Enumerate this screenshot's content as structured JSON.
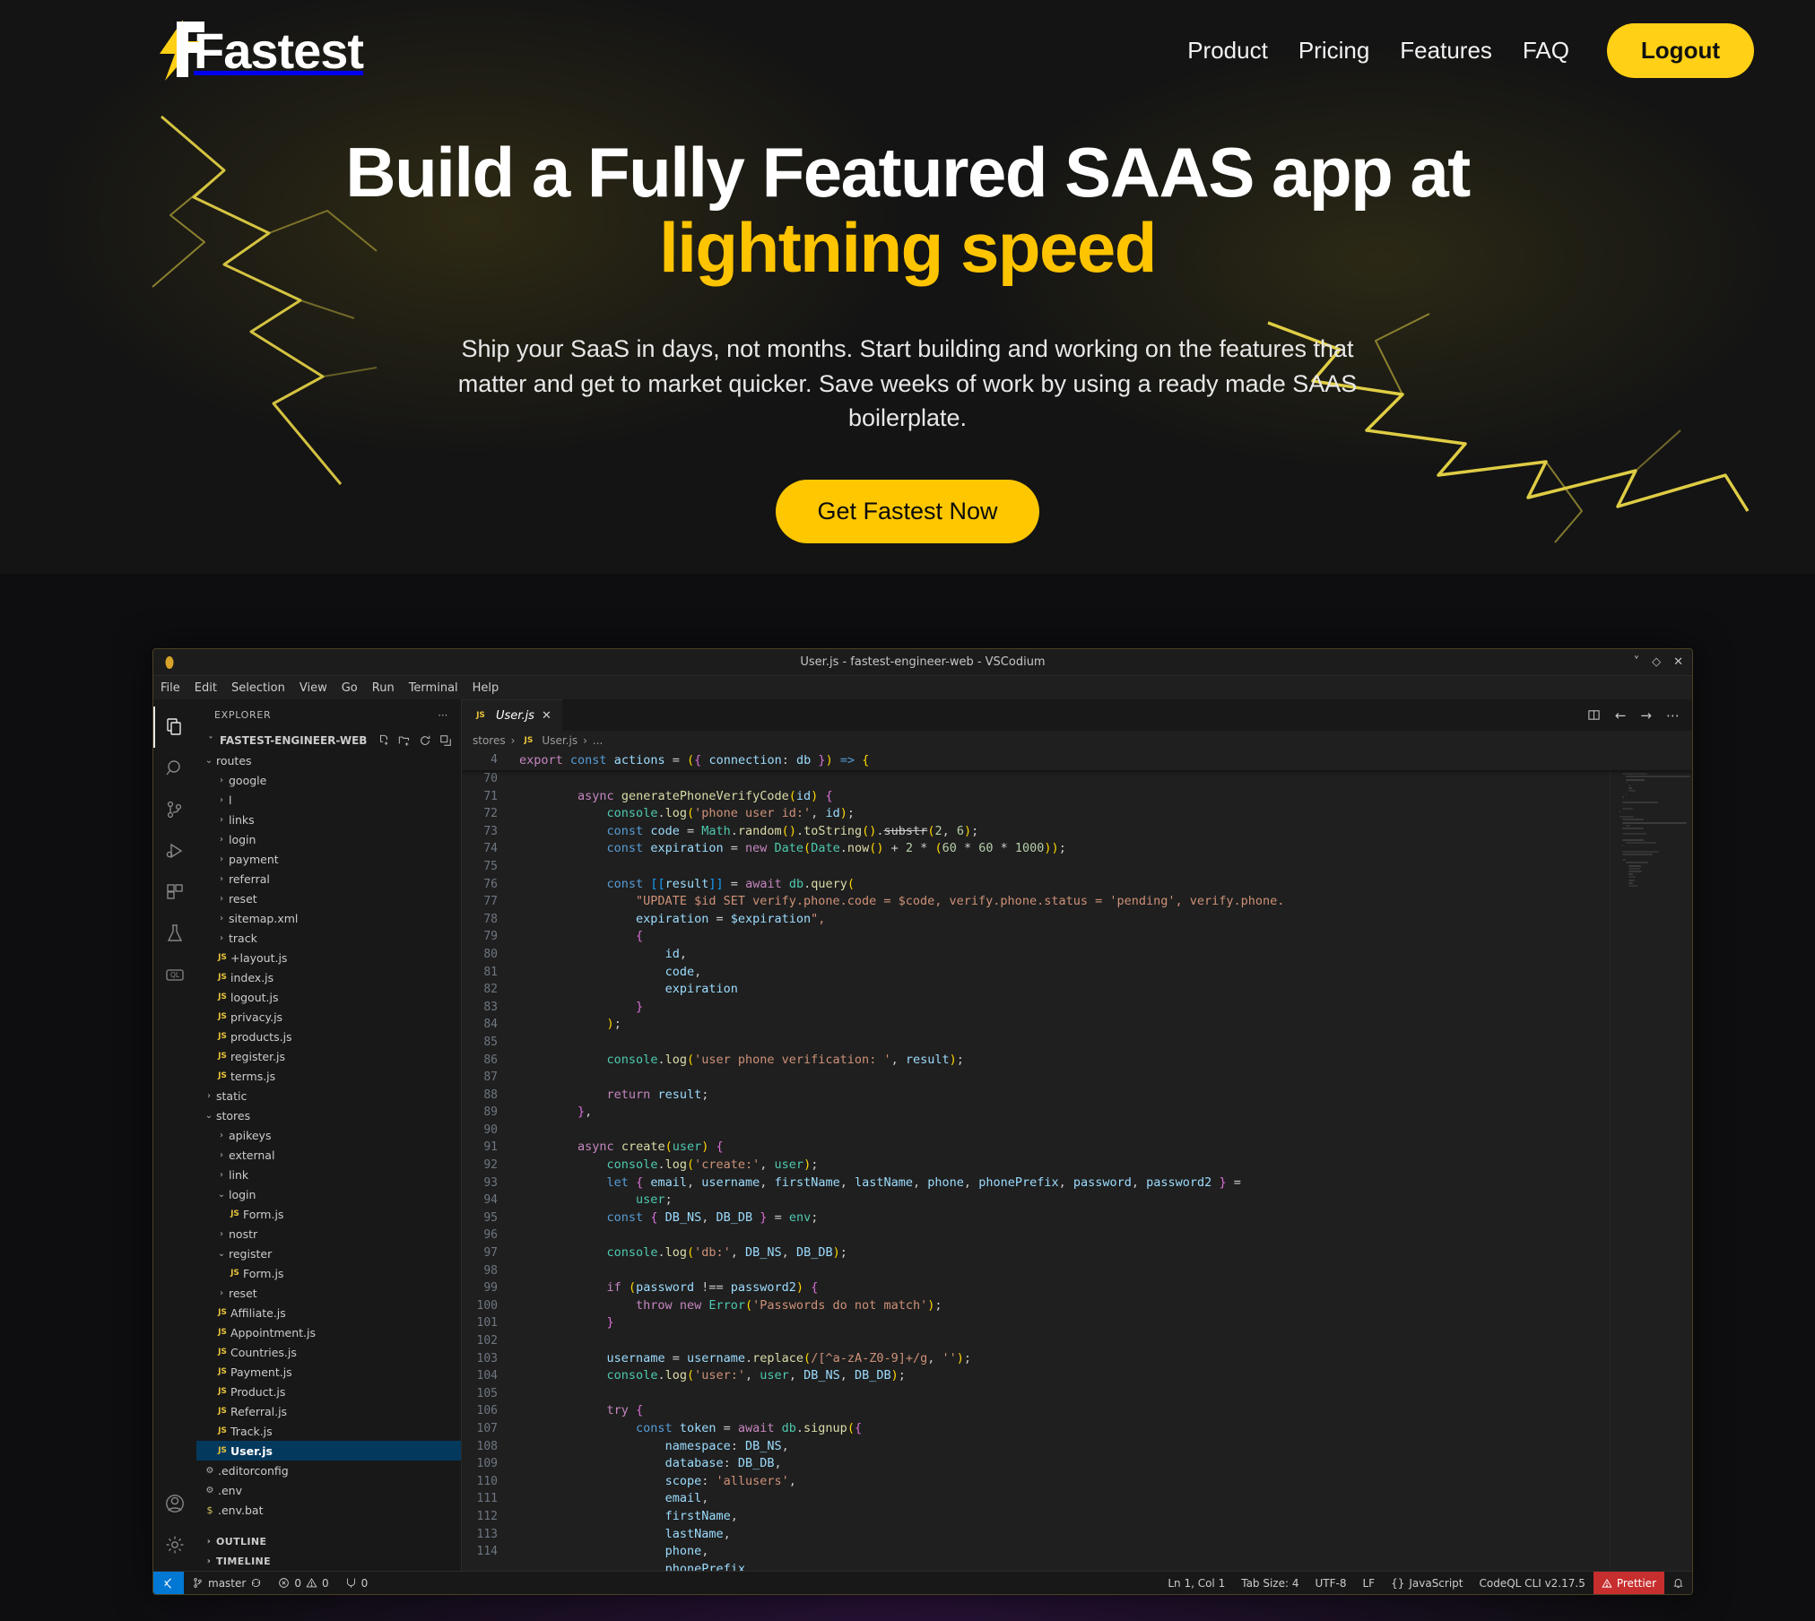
{
  "brand": {
    "name": "Fastest",
    "logo_icon": "lightning-bolt-icon"
  },
  "nav": {
    "links": [
      {
        "label": "Product"
      },
      {
        "label": "Pricing"
      },
      {
        "label": "Features"
      },
      {
        "label": "FAQ"
      }
    ],
    "logout_label": "Logout",
    "accent_color": "#FFD015"
  },
  "hero": {
    "headline_line1": "Build a Fully Featured SAAS app at",
    "headline_line2": "lightning speed",
    "subtitle": "Ship your SaaS in days, not months. Start building and working on the features that matter and get to market quicker. Save weeks of work by using a ready made SAAS boilerplate.",
    "cta_label": "Get Fastest Now",
    "accent_color": "#FFC400"
  },
  "editor": {
    "window_title": "User.js - fastest-engineer-web - VSCodium",
    "window_controls": {
      "minimize": "chevron-down-icon",
      "maximize": "diamond-icon",
      "close": "close-icon"
    },
    "menu": [
      "File",
      "Edit",
      "Selection",
      "View",
      "Go",
      "Run",
      "Terminal",
      "Help"
    ],
    "activity_bar": [
      {
        "name": "explorer-icon",
        "label": "Explorer",
        "active": true
      },
      {
        "name": "search-icon",
        "label": "Search",
        "active": false
      },
      {
        "name": "source-control-icon",
        "label": "Source Control",
        "active": false
      },
      {
        "name": "run-debug-icon",
        "label": "Run and Debug",
        "active": false
      },
      {
        "name": "extensions-icon",
        "label": "Extensions",
        "active": false
      },
      {
        "name": "testing-flask-icon",
        "label": "Testing",
        "active": false
      },
      {
        "name": "codeql-icon",
        "label": "CodeQL",
        "active": false
      }
    ],
    "activity_bar_bottom": [
      {
        "name": "account-icon",
        "label": "Accounts"
      },
      {
        "name": "gear-icon",
        "label": "Manage"
      }
    ],
    "explorer": {
      "title": "EXPLORER",
      "more_icon": "ellipsis-icon",
      "root": "FASTEST-ENGINEER-WEB",
      "root_actions": [
        "new-file-icon",
        "new-folder-icon",
        "refresh-icon",
        "collapse-all-icon"
      ],
      "tree": [
        {
          "label": "routes",
          "type": "folder",
          "state": "open",
          "depth": 1
        },
        {
          "label": "google",
          "type": "folder",
          "state": "closed",
          "depth": 2,
          "clipped": true
        },
        {
          "label": "l",
          "type": "folder",
          "state": "closed",
          "depth": 2
        },
        {
          "label": "links",
          "type": "folder",
          "state": "closed",
          "depth": 2
        },
        {
          "label": "login",
          "type": "folder",
          "state": "closed",
          "depth": 2
        },
        {
          "label": "payment",
          "type": "folder",
          "state": "closed",
          "depth": 2
        },
        {
          "label": "referral",
          "type": "folder",
          "state": "closed",
          "depth": 2
        },
        {
          "label": "reset",
          "type": "folder",
          "state": "closed",
          "depth": 2
        },
        {
          "label": "sitemap.xml",
          "type": "folder",
          "state": "closed",
          "depth": 2
        },
        {
          "label": "track",
          "type": "folder",
          "state": "closed",
          "depth": 2
        },
        {
          "label": "+layout.js",
          "type": "js",
          "depth": 2
        },
        {
          "label": "index.js",
          "type": "js",
          "depth": 2
        },
        {
          "label": "logout.js",
          "type": "js",
          "depth": 2
        },
        {
          "label": "privacy.js",
          "type": "js",
          "depth": 2
        },
        {
          "label": "products.js",
          "type": "js",
          "depth": 2
        },
        {
          "label": "register.js",
          "type": "js",
          "depth": 2
        },
        {
          "label": "terms.js",
          "type": "js",
          "depth": 2
        },
        {
          "label": "static",
          "type": "folder",
          "state": "closed",
          "depth": 1
        },
        {
          "label": "stores",
          "type": "folder",
          "state": "open",
          "depth": 1
        },
        {
          "label": "apikeys",
          "type": "folder",
          "state": "closed",
          "depth": 2
        },
        {
          "label": "external",
          "type": "folder",
          "state": "closed",
          "depth": 2
        },
        {
          "label": "link",
          "type": "folder",
          "state": "closed",
          "depth": 2
        },
        {
          "label": "login",
          "type": "folder",
          "state": "open",
          "depth": 2
        },
        {
          "label": "Form.js",
          "type": "js",
          "depth": 3
        },
        {
          "label": "nostr",
          "type": "folder",
          "state": "closed",
          "depth": 2
        },
        {
          "label": "register",
          "type": "folder",
          "state": "open",
          "depth": 2
        },
        {
          "label": "Form.js",
          "type": "js",
          "depth": 3
        },
        {
          "label": "reset",
          "type": "folder",
          "state": "closed",
          "depth": 2
        },
        {
          "label": "Affiliate.js",
          "type": "js",
          "depth": 2
        },
        {
          "label": "Appointment.js",
          "type": "js",
          "depth": 2
        },
        {
          "label": "Countries.js",
          "type": "js",
          "depth": 2
        },
        {
          "label": "Payment.js",
          "type": "js",
          "depth": 2
        },
        {
          "label": "Product.js",
          "type": "js",
          "depth": 2
        },
        {
          "label": "Referral.js",
          "type": "js",
          "depth": 2
        },
        {
          "label": "Track.js",
          "type": "js",
          "depth": 2
        },
        {
          "label": "User.js",
          "type": "js",
          "depth": 2,
          "selected": true
        },
        {
          "label": ".editorconfig",
          "type": "gear",
          "depth": 1
        },
        {
          "label": ".env",
          "type": "gear",
          "depth": 1
        },
        {
          "label": ".env.bat",
          "type": "shell",
          "depth": 1,
          "clipped": true
        }
      ],
      "sections": [
        {
          "label": "OUTLINE",
          "state": "closed"
        },
        {
          "label": "TIMELINE",
          "state": "closed"
        }
      ]
    },
    "tab": {
      "label": "User.js",
      "icon": "js-icon",
      "close_icon": "close-icon",
      "modified": false
    },
    "editor_actions": [
      "split-editor-icon",
      "back-arrow-icon",
      "forward-arrow-icon",
      "ellipsis-icon"
    ],
    "breadcrumb": [
      "stores",
      "User.js",
      "..."
    ],
    "sticky_line": {
      "number": "4",
      "text": "export const actions = (({ connection: db }) => {"
    },
    "code_lines": [
      {
        "n": "70",
        "text": ""
      },
      {
        "n": "71",
        "text": "        async generatePhoneVerifyCode(id) {"
      },
      {
        "n": "72",
        "text": "            console.log('phone user id:', id);"
      },
      {
        "n": "73",
        "text": "            const code = Math.random().toString().substr(2, 6);"
      },
      {
        "n": "74",
        "text": "            const expiration = new Date(Date.now() + 2 * (60 * 60 * 1000));"
      },
      {
        "n": "75",
        "text": ""
      },
      {
        "n": "76",
        "text": "            const [[result]] = await db.query("
      },
      {
        "n": "77",
        "text": "                \"UPDATE $id SET verify.phone.code = $code, verify.phone.status = 'pending', verify.phone."
      },
      {
        "n": "",
        "text": "                expiration = $expiration\","
      },
      {
        "n": "78",
        "text": "                {"
      },
      {
        "n": "79",
        "text": "                    id,"
      },
      {
        "n": "80",
        "text": "                    code,"
      },
      {
        "n": "81",
        "text": "                    expiration"
      },
      {
        "n": "82",
        "text": "                }"
      },
      {
        "n": "83",
        "text": "            );"
      },
      {
        "n": "84",
        "text": ""
      },
      {
        "n": "85",
        "text": "            console.log('user phone verification: ', result);"
      },
      {
        "n": "86",
        "text": ""
      },
      {
        "n": "87",
        "text": "            return result;"
      },
      {
        "n": "88",
        "text": "        },"
      },
      {
        "n": "89",
        "text": ""
      },
      {
        "n": "90",
        "text": "        async create(user) {"
      },
      {
        "n": "91",
        "text": "            console.log('create:', user);"
      },
      {
        "n": "92",
        "text": "            let { email, username, firstName, lastName, phone, phonePrefix, password, password2 } ="
      },
      {
        "n": "93",
        "text": "                user;"
      },
      {
        "n": "94",
        "text": "            const { DB_NS, DB_DB } = env;"
      },
      {
        "n": "95",
        "text": ""
      },
      {
        "n": "96",
        "text": "            console.log('db:', DB_NS, DB_DB);"
      },
      {
        "n": "97",
        "text": ""
      },
      {
        "n": "98",
        "text": "            if (password !== password2) {"
      },
      {
        "n": "99",
        "text": "                throw new Error('Passwords do not match');"
      },
      {
        "n": "100",
        "text": "            }"
      },
      {
        "n": "101",
        "text": ""
      },
      {
        "n": "102",
        "text": "            username = username.replace(/[^a-zA-Z0-9]+/g, '');"
      },
      {
        "n": "103",
        "text": "            console.log('user:', user, DB_NS, DB_DB);"
      },
      {
        "n": "104",
        "text": ""
      },
      {
        "n": "105",
        "text": "            try {"
      },
      {
        "n": "106",
        "text": "                const token = await db.signup({"
      },
      {
        "n": "107",
        "text": "                    namespace: DB_NS,"
      },
      {
        "n": "108",
        "text": "                    database: DB_DB,"
      },
      {
        "n": "109",
        "text": "                    scope: 'allusers',"
      },
      {
        "n": "110",
        "text": "                    email,"
      },
      {
        "n": "111",
        "text": "                    firstName,"
      },
      {
        "n": "112",
        "text": "                    lastName,"
      },
      {
        "n": "113",
        "text": "                    phone,"
      },
      {
        "n": "114",
        "text": "                    phonePrefix,"
      }
    ],
    "status_bar": {
      "remote_icon": "remote-window-icon",
      "branch": "master",
      "sync_icon": "sync-icon",
      "errors_icon": "error-icon",
      "errors": "0",
      "warnings_icon": "warning-icon",
      "warnings": "0",
      "ports_icon": "ports-icon",
      "ports": "0",
      "cursor_position": "Ln 1, Col 1",
      "tab_size": "Tab Size: 4",
      "encoding": "UTF-8",
      "eol": "LF",
      "language": "JavaScript",
      "language_icon": "braces-icon",
      "codeql": "CodeQL CLI v2.17.5",
      "prettier": "Prettier",
      "prettier_icon": "warning-icon",
      "prettier_color": "#c72e2e",
      "bell_icon": "bell-icon"
    }
  }
}
